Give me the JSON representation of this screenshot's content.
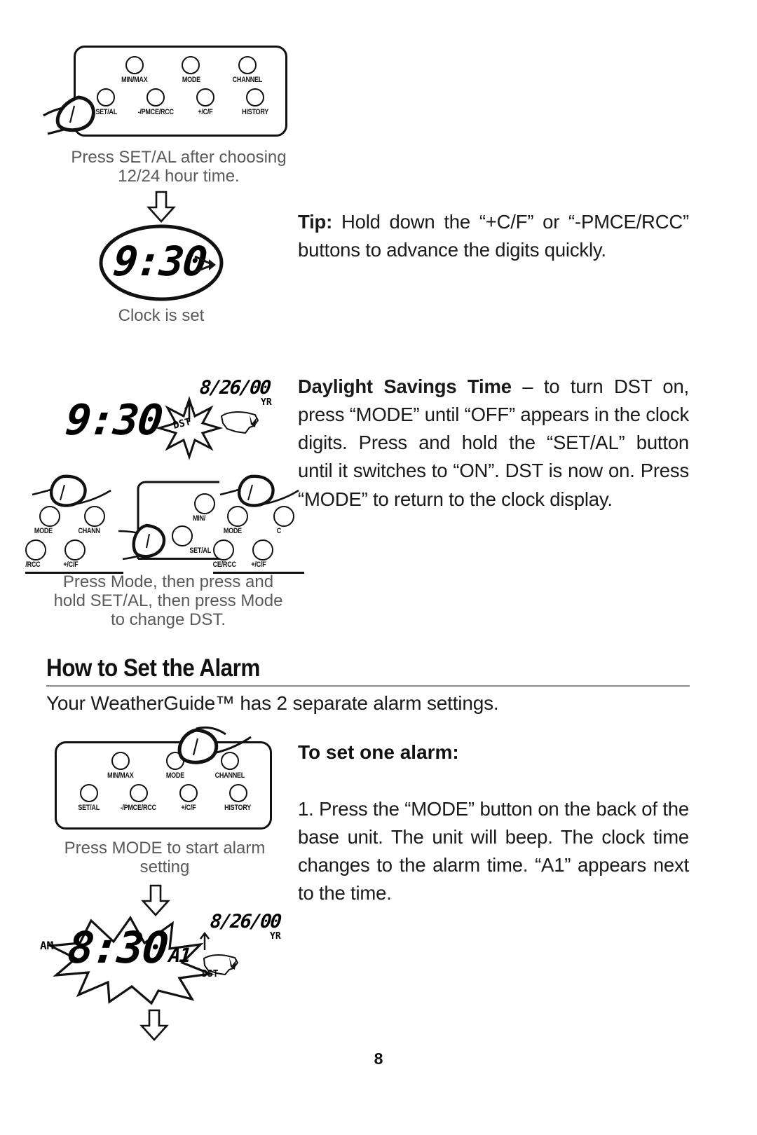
{
  "page": {
    "number": "8"
  },
  "sections": {
    "clock_set": {
      "panel": {
        "row1": [
          {
            "label": "MIN/MAX"
          },
          {
            "label": "MODE"
          },
          {
            "label": "CHANNEL"
          }
        ],
        "row2": [
          {
            "label": "SET/AL"
          },
          {
            "label": "-/PMCE/RCC"
          },
          {
            "label": "+/C/F"
          },
          {
            "label": "HISTORY"
          }
        ]
      },
      "caption_line1": "Press SET/AL after choosing",
      "caption_line2": "12/24 hour time.",
      "display": {
        "time": "9:30"
      },
      "display_caption": "Clock is set"
    },
    "tip": {
      "label": "Tip:",
      "text": " Hold down the “+C/F” or “-PMCE/RCC” buttons to advance the digits quickly."
    },
    "dst": {
      "display": {
        "time": "9:30",
        "badge": "DST",
        "date": "8/26/00",
        "date_unit": "YR"
      },
      "panels": {
        "left": {
          "row1": [
            "MODE",
            "CHANN"
          ],
          "row2": [
            "/RCC",
            "+/C/F"
          ]
        },
        "middle": {
          "row1": [
            "MIN/"
          ],
          "row2": [
            "SET/AL"
          ]
        },
        "right": {
          "row1": [
            "MODE",
            "C"
          ],
          "row2": [
            "CE/RCC",
            "+/C/F"
          ]
        }
      },
      "caption_line1": "Press Mode, then press and",
      "caption_line2": "hold SET/AL, then press Mode",
      "caption_line3": "to change DST.",
      "heading": "Daylight Savings Time",
      "text": " – to turn DST on, press “MODE” until “OFF” appears in the clock digits. Press and hold the “SET/AL” button until it switches to “ON”. DST is now on. Press “MODE” to return to the clock display."
    },
    "alarm": {
      "heading": "How to Set the Alarm",
      "subhead": "Your WeatherGuide™ has 2 separate alarm settings.",
      "panel": {
        "row1": [
          {
            "label": "MIN/MAX"
          },
          {
            "label": "MODE"
          },
          {
            "label": "CHANNEL"
          }
        ],
        "row2": [
          {
            "label": "SET/AL"
          },
          {
            "label": "-/PMCE/RCC"
          },
          {
            "label": "+/C/F"
          },
          {
            "label": "HISTORY"
          }
        ]
      },
      "caption_line1": "Press MODE to start alarm",
      "caption_line2": "setting",
      "display": {
        "meridiem": "AM",
        "time": "8:30",
        "alarm_tag": "A1",
        "date": "8/26/00",
        "date_unit": "YR",
        "dst_label": "DST"
      },
      "step_heading": "To set one alarm:",
      "step_number": "1.",
      "step_text": " Press the “MODE” button on the back of the base unit. The unit will beep. The clock time changes to the alarm time. “A1” appears next to the time."
    }
  }
}
